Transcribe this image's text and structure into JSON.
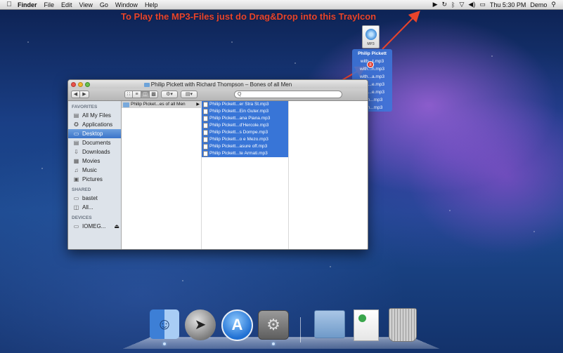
{
  "menubar": {
    "apple": "",
    "app": "Finder",
    "menus": [
      "File",
      "Edit",
      "View",
      "Go",
      "Window",
      "Help"
    ],
    "clock": "Thu 5:30 PM",
    "user": "Demo"
  },
  "annotation": "To Play the MP3-Files just do Drag&Drop into this TrayIcon",
  "drag": {
    "file_ext": "MP3",
    "items": [
      "Philip Pickett",
      "with...t.mp3",
      "with...n.mp3",
      "with...a.mp3",
      "with...e.mp3",
      "with...e.mp3",
      "with...mp3",
      "with...mp3",
      "with...i.mp3"
    ],
    "badge": "8"
  },
  "finder": {
    "title": "Philip Pickett with Richard Thompson – Bones of all Men",
    "search_placeholder": "Q",
    "sidebar": {
      "favorites_header": "FAVORITES",
      "favorites": [
        "All My Files",
        "Applications",
        "Desktop",
        "Documents",
        "Downloads",
        "Movies",
        "Music",
        "Pictures"
      ],
      "shared_header": "SHARED",
      "shared": [
        "bastet",
        "All..."
      ],
      "devices_header": "DEVICES",
      "devices": [
        "IOMEG..."
      ]
    },
    "column1": [
      "Philip Picket...es of all Men"
    ],
    "column2": [
      "Philip Pickett...er Stra St.mp3",
      "Philip Pickett...Ein Guter.mp3",
      "Philip Pickett...ana Piana.mp3",
      "Philip Pickett...d'Hercole.mp3",
      "Philip Pickett...s Dompe.mp3",
      "Philip Pickett...o e Mezo.mp3",
      "Philip Pickett...asure off.mp3",
      "Philip Pickett...te Armati.mp3"
    ]
  },
  "colors": {
    "annotation": "#e8442b",
    "selection": "#3875d7"
  },
  "icons": {
    "sidebar": [
      "all-files-icon",
      "applications-icon",
      "desktop-icon",
      "documents-icon",
      "downloads-icon",
      "movies-icon",
      "music-icon",
      "pictures-icon"
    ]
  }
}
